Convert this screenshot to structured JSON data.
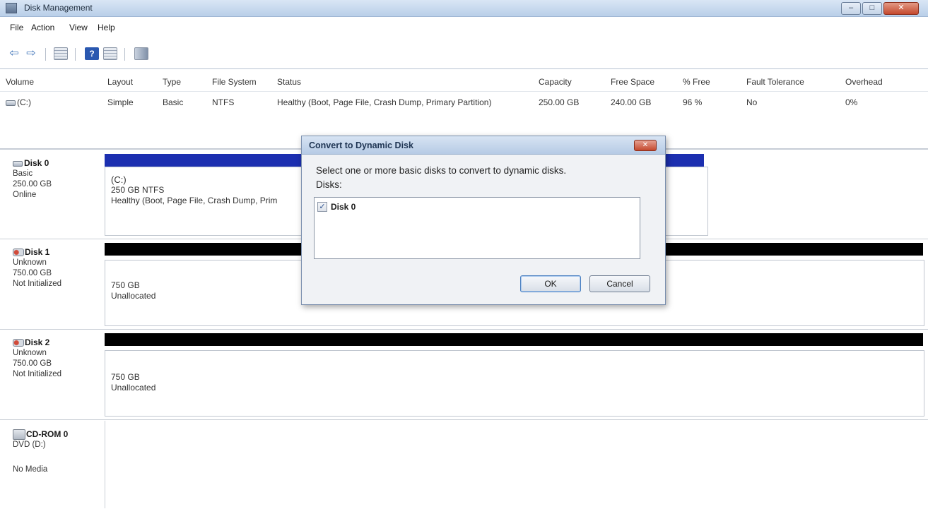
{
  "window": {
    "title": "Disk Management",
    "controls": {
      "minimize": "–",
      "maximize": "□",
      "close": "✕"
    }
  },
  "menu": [
    "File",
    "Action",
    "View",
    "Help"
  ],
  "toolbar": {
    "back": "⇦",
    "forward": "⇨",
    "help": "?"
  },
  "volume_table": {
    "columns": [
      "Volume",
      "Layout",
      "Type",
      "File System",
      "Status",
      "Capacity",
      "Free Space",
      "% Free",
      "Fault Tolerance",
      "Overhead"
    ],
    "rows": [
      [
        "(C:)",
        "Simple",
        "Basic",
        "NTFS",
        "Healthy (Boot, Page File, Crash Dump, Primary Partition)",
        "250.00 GB",
        "240.00 GB",
        "96 %",
        "No",
        "0%"
      ]
    ]
  },
  "disks": [
    {
      "name": "Disk 0",
      "type": "Basic",
      "size": "250.00 GB",
      "status": "Online",
      "partition": {
        "label": "(C:)",
        "fs": "250 GB NTFS",
        "status": "Healthy (Boot, Page File, Crash Dump, Prim"
      },
      "bar_color": "#1c2fb0"
    },
    {
      "name": "Disk 1",
      "type": "Unknown",
      "size": "750.00 GB",
      "status": "Not Initialized",
      "partition": {
        "size": "750 GB",
        "status": "Unallocated"
      },
      "bar_color": "#000000"
    },
    {
      "name": "Disk 2",
      "type": "Unknown",
      "size": "750.00 GB",
      "status": "Not Initialized",
      "partition": {
        "size": "750 GB",
        "status": "Unallocated"
      },
      "bar_color": "#000000"
    },
    {
      "name": "CD-ROM 0",
      "type": "DVD (D:)",
      "status": "No Media"
    }
  ],
  "dialog": {
    "title": "Convert to Dynamic Disk",
    "close": "✕",
    "prompt": "Select one or more basic disks to convert to dynamic disks.",
    "disks_label": "Disks:",
    "items": [
      {
        "label": "Disk 0",
        "checked": true,
        "check_glyph": "✓"
      }
    ],
    "ok": "OK",
    "cancel": "Cancel"
  }
}
